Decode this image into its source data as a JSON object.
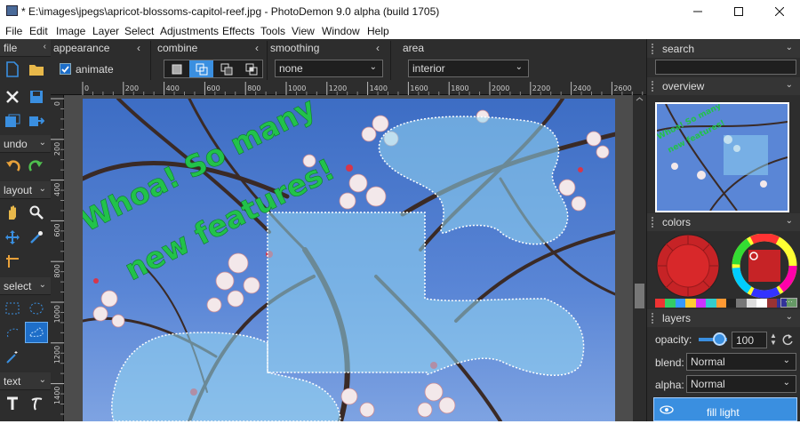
{
  "window": {
    "title": "* E:\\images\\jpegs\\apricot-blossoms-capitol-reef.jpg  -  PhotoDemon 9.0 alpha (build 1705)"
  },
  "menu": [
    "File",
    "Edit",
    "Image",
    "Layer",
    "Select",
    "Adjustments",
    "Effects",
    "Tools",
    "View",
    "Window",
    "Help"
  ],
  "left_toolbox": {
    "sections": [
      {
        "label": "file"
      },
      {
        "label": "undo"
      },
      {
        "label": "layout"
      },
      {
        "label": "select"
      },
      {
        "label": "text"
      }
    ]
  },
  "options_bar": {
    "appearance": {
      "label": "appearance",
      "animate_label": "animate",
      "animate_checked": true
    },
    "combine": {
      "label": "combine"
    },
    "smoothing": {
      "label": "smoothing",
      "value": "none"
    },
    "area": {
      "label": "area",
      "value": "interior"
    }
  },
  "ruler": {
    "top_ticks": [
      "0",
      "200",
      "400",
      "600",
      "800",
      "1000",
      "1200",
      "1400",
      "1600",
      "1800",
      "2000",
      "2200",
      "2400",
      "2600"
    ],
    "left_ticks": [
      "0",
      "200",
      "400",
      "600",
      "800",
      "1000",
      "1200",
      "1400"
    ]
  },
  "canvas": {
    "overlay_text_line1": "Whoa!  So many",
    "overlay_text_line2": "new features!",
    "overlay_color": "#22c24a"
  },
  "right_panel": {
    "search": {
      "label": "search",
      "value": ""
    },
    "overview": {
      "label": "overview"
    },
    "colors": {
      "label": "colors",
      "primary_color": "#d8282a"
    },
    "layers": {
      "label": "layers",
      "opacity_label": "opacity:",
      "opacity_value": "100",
      "blend_label": "blend:",
      "blend_value": "Normal",
      "alpha_label": "alpha:",
      "alpha_value": "Normal",
      "layer_name": "fill light"
    }
  }
}
